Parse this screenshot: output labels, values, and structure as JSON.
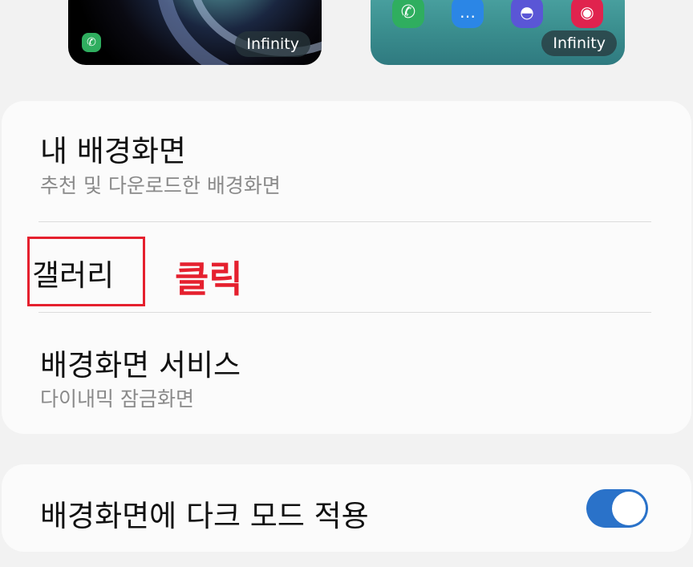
{
  "previews": {
    "lock_badge": "Infinity",
    "home_badge": "Infinity",
    "home_icons": [
      "phone-icon",
      "messages-icon",
      "messenger-icon",
      "camera-icon"
    ],
    "icon_colors": {
      "phone": "#2fae5f",
      "messages": "#2b86e6",
      "messenger": "#5a56d6",
      "camera": "#e0234e"
    }
  },
  "menu": {
    "my_wallpapers": {
      "title": "내 배경화면",
      "subtitle": "추천 및 다운로드한 배경화면"
    },
    "gallery": {
      "title": "갤러리"
    },
    "wallpaper_services": {
      "title": "배경화면 서비스",
      "subtitle": "다이내믹 잠금화면"
    }
  },
  "annotation": {
    "click_label": "클릭",
    "color": "#e5202e"
  },
  "dark_mode": {
    "title": "배경화면에 다크 모드 적용",
    "enabled": true,
    "toggle_color": "#2a72c9"
  }
}
